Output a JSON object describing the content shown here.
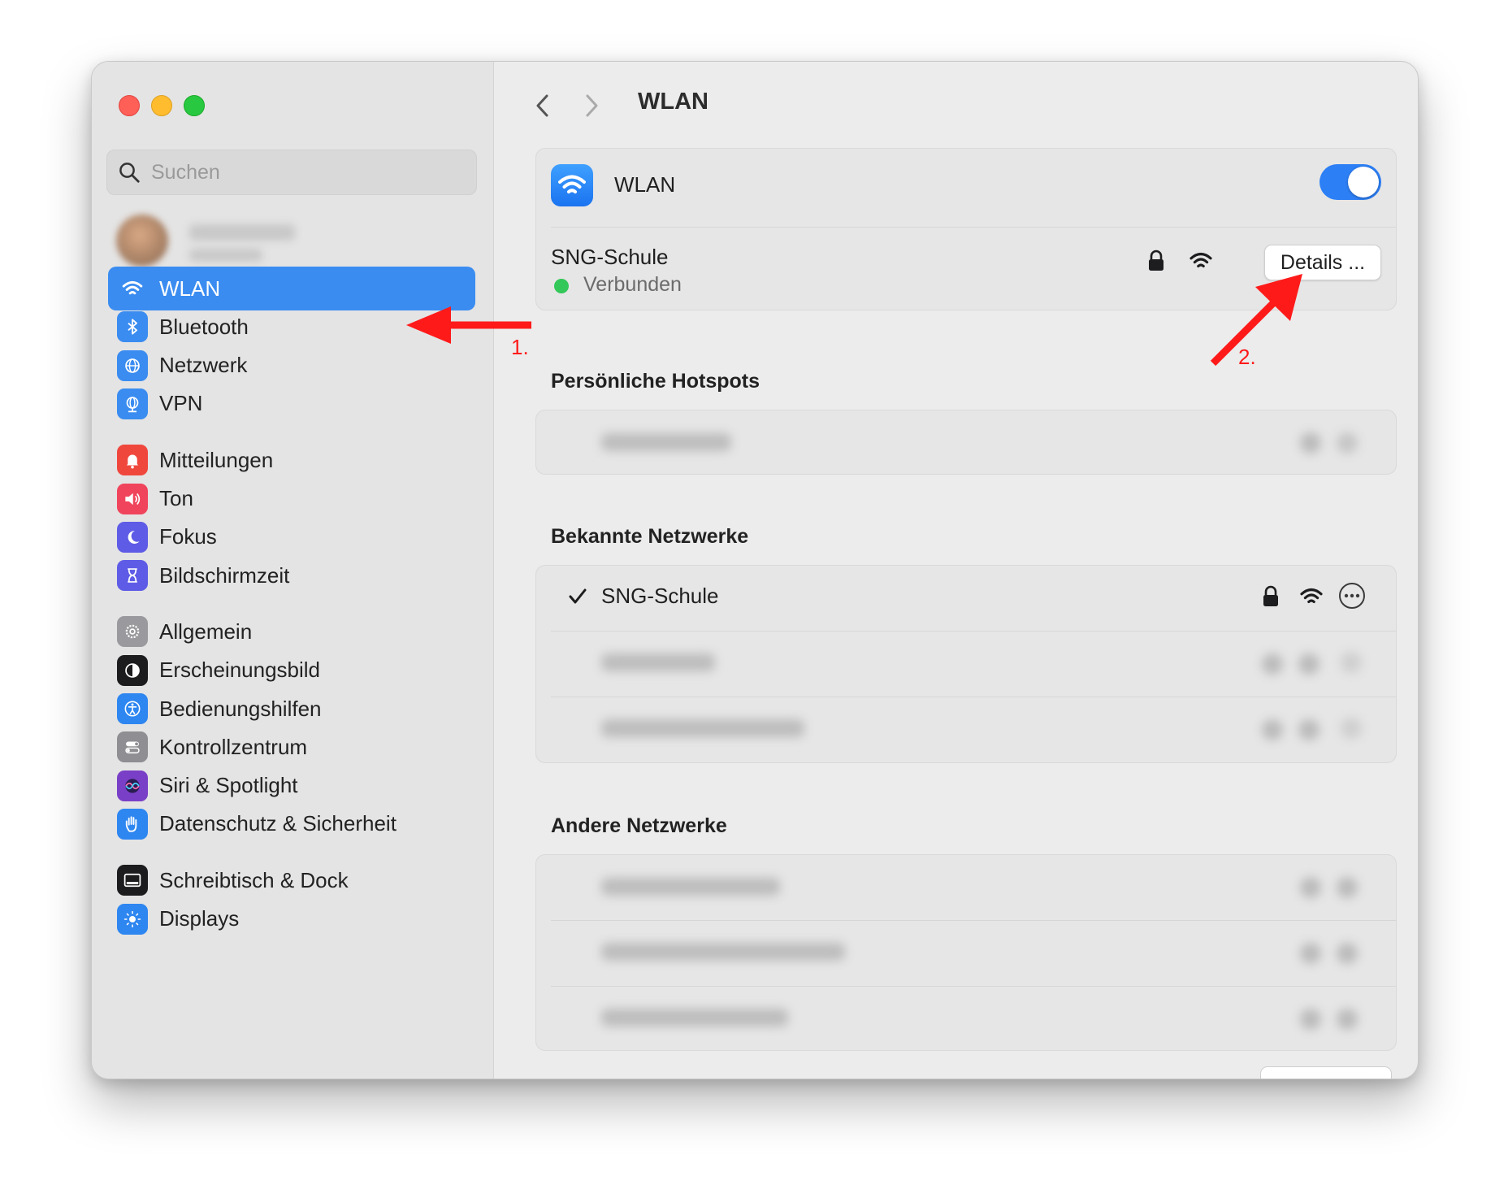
{
  "window": {
    "title": "WLAN"
  },
  "sidebar": {
    "search_placeholder": "Suchen",
    "groups": [
      [
        {
          "label": "WLAN",
          "icon": "wifi-icon",
          "color": "#3a8cf0",
          "active": true
        },
        {
          "label": "Bluetooth",
          "icon": "bluetooth-icon",
          "color": "#3a8cf0"
        },
        {
          "label": "Netzwerk",
          "icon": "globe-icon",
          "color": "#3a8cf0"
        },
        {
          "label": "VPN",
          "icon": "vpn-globe-icon",
          "color": "#3a8cf0"
        }
      ],
      [
        {
          "label": "Mitteilungen",
          "icon": "bell-icon",
          "color": "#f0473d"
        },
        {
          "label": "Ton",
          "icon": "speaker-icon",
          "color": "#f0445c"
        },
        {
          "label": "Fokus",
          "icon": "moon-icon",
          "color": "#5e5ce6"
        },
        {
          "label": "Bildschirmzeit",
          "icon": "hourglass-icon",
          "color": "#5e5ce6"
        }
      ],
      [
        {
          "label": "Allgemein",
          "icon": "gear-icon",
          "color": "#9a9a9e"
        },
        {
          "label": "Erscheinungsbild",
          "icon": "appearance-icon",
          "color": "#1c1c1e"
        },
        {
          "label": "Bedienungshilfen",
          "icon": "accessibility-icon",
          "color": "#2e86f0"
        },
        {
          "label": "Kontrollzentrum",
          "icon": "switches-icon",
          "color": "#8e8e93"
        },
        {
          "label": "Siri & Spotlight",
          "icon": "siri-icon",
          "color": "#7a3fc7"
        },
        {
          "label": "Datenschutz & Sicherheit",
          "icon": "hand-icon",
          "color": "#2e86f0"
        }
      ],
      [
        {
          "label": "Schreibtisch & Dock",
          "icon": "dock-icon",
          "color": "#1c1c1e"
        },
        {
          "label": "Displays",
          "icon": "sun-icon",
          "color": "#2e86f0"
        }
      ]
    ]
  },
  "main": {
    "title": "WLAN",
    "wlan_label": "WLAN",
    "wlan_on": true,
    "current_network": {
      "name": "SNG-Schule",
      "status": "Verbunden",
      "status_color": "#34c759",
      "details_label": "Details ..."
    },
    "hotspots_title": "Persönliche Hotspots",
    "known_title": "Bekannte Netzwerke",
    "known_networks": [
      {
        "name": "SNG-Schule",
        "connected": true
      }
    ],
    "other_title": "Andere Netzwerke"
  },
  "annotations": {
    "step1": "1.",
    "step2": "2.",
    "arrow_color": "#ff1a1a"
  }
}
